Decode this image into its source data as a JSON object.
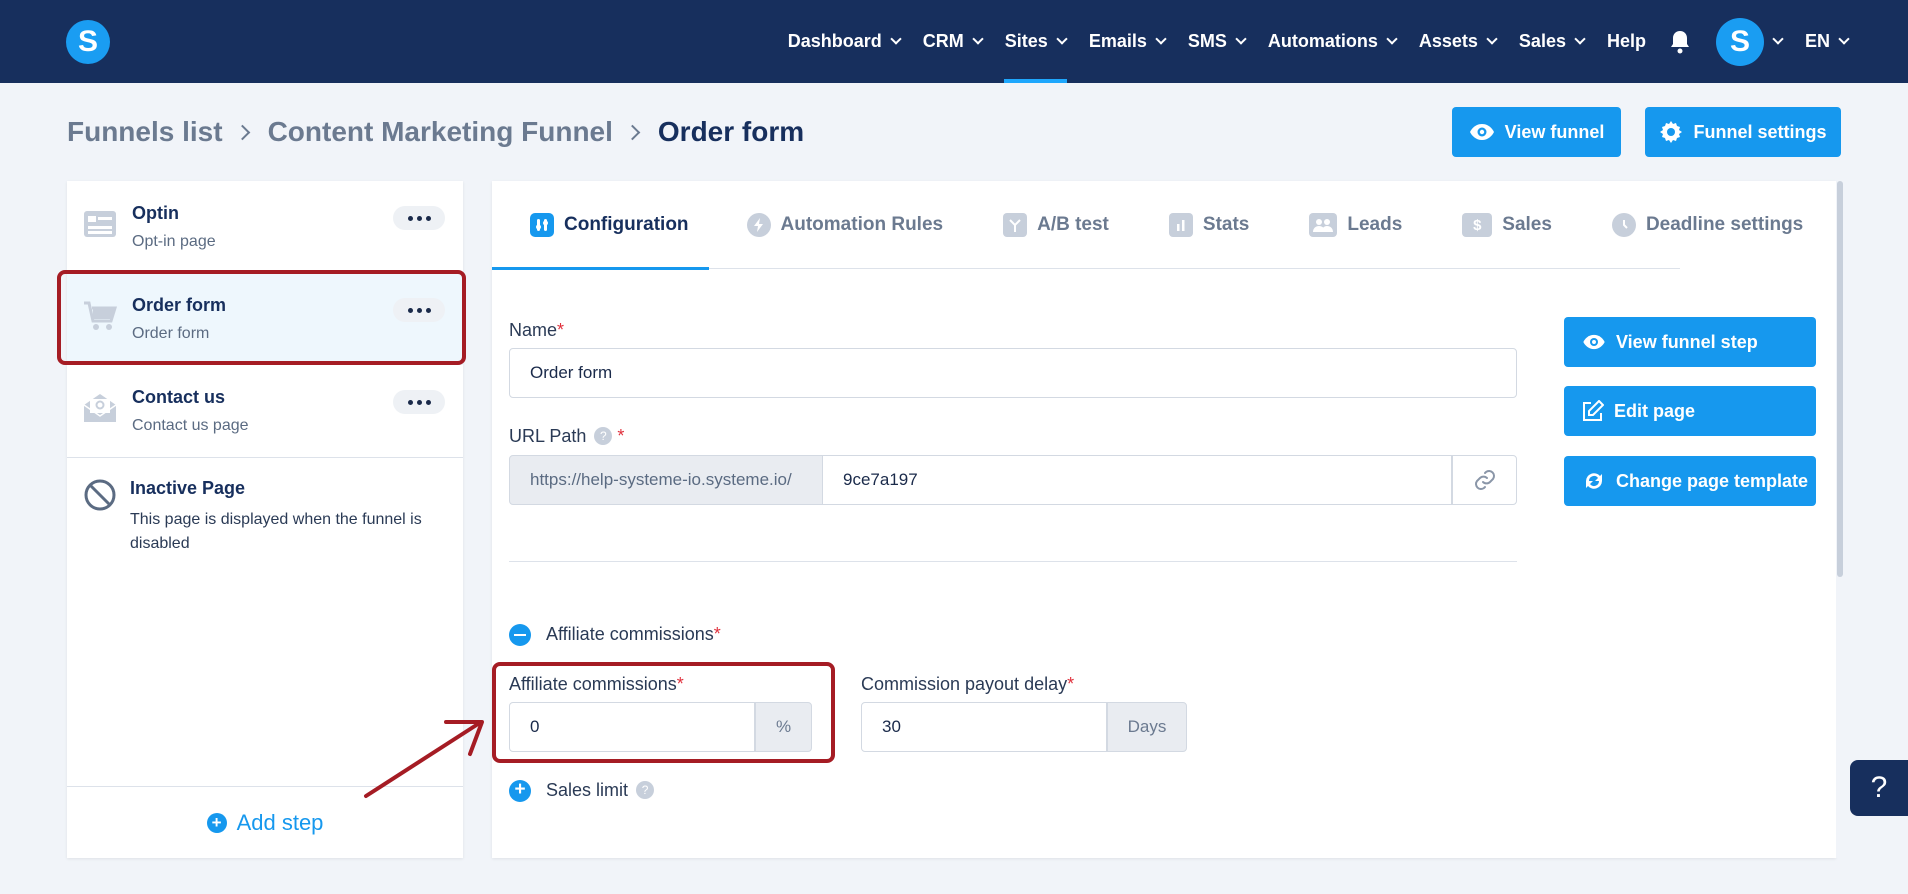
{
  "nav": {
    "items": [
      {
        "label": "Dashboard",
        "chevron": true
      },
      {
        "label": "CRM",
        "chevron": true
      },
      {
        "label": "Sites",
        "chevron": true,
        "active": true
      },
      {
        "label": "Emails",
        "chevron": true
      },
      {
        "label": "SMS",
        "chevron": true
      },
      {
        "label": "Automations",
        "chevron": true
      },
      {
        "label": "Assets",
        "chevron": true
      },
      {
        "label": "Sales",
        "chevron": true
      },
      {
        "label": "Help",
        "chevron": false
      }
    ],
    "logo_letter": "S",
    "avatar_letter": "S",
    "language": "EN"
  },
  "breadcrumb": {
    "items": [
      "Funnels list",
      "Content Marketing Funnel"
    ],
    "current": "Order form"
  },
  "header_buttons": {
    "view_funnel": "View funnel",
    "funnel_settings": "Funnel settings"
  },
  "steps": [
    {
      "title": "Optin",
      "subtitle": "Opt-in page",
      "icon": "form-page-icon"
    },
    {
      "title": "Order form",
      "subtitle": "Order form",
      "icon": "cart-icon",
      "selected": true
    },
    {
      "title": "Contact us",
      "subtitle": "Contact us page",
      "icon": "mail-icon"
    }
  ],
  "inactive_page": {
    "title": "Inactive Page",
    "description": "This page is displayed when the funnel is disabled"
  },
  "add_step_label": "Add step",
  "tabs": [
    {
      "label": "Configuration",
      "active": true,
      "icon": "config-icon"
    },
    {
      "label": "Automation Rules",
      "icon": "bolt-icon"
    },
    {
      "label": "A/B test",
      "icon": "split-icon"
    },
    {
      "label": "Stats",
      "icon": "stats-icon"
    },
    {
      "label": "Leads",
      "icon": "users-icon"
    },
    {
      "label": "Sales",
      "icon": "dollar-icon"
    },
    {
      "label": "Deadline settings",
      "icon": "clock-icon"
    }
  ],
  "form": {
    "name_label": "Name",
    "name_value": "Order form",
    "url_label": "URL Path",
    "url_prefix": "https://help-systeme-io.systeme.io/",
    "url_value": "9ce7a197",
    "affiliate_section_label": "Affiliate commissions",
    "affiliate_label": "Affiliate commissions",
    "affiliate_value": "0",
    "affiliate_unit": "%",
    "payout_label": "Commission payout delay",
    "payout_value": "30",
    "payout_unit": "Days",
    "sales_limit_label": "Sales limit",
    "required_mark": "*",
    "help_mark": "?"
  },
  "side_buttons": {
    "view_step": "View funnel step",
    "edit_page": "Edit page",
    "change_template": "Change page template"
  },
  "help_fab": "?",
  "colors": {
    "nav_bg": "#172f5d",
    "accent": "#1698ee",
    "highlight": "#a51c24"
  }
}
